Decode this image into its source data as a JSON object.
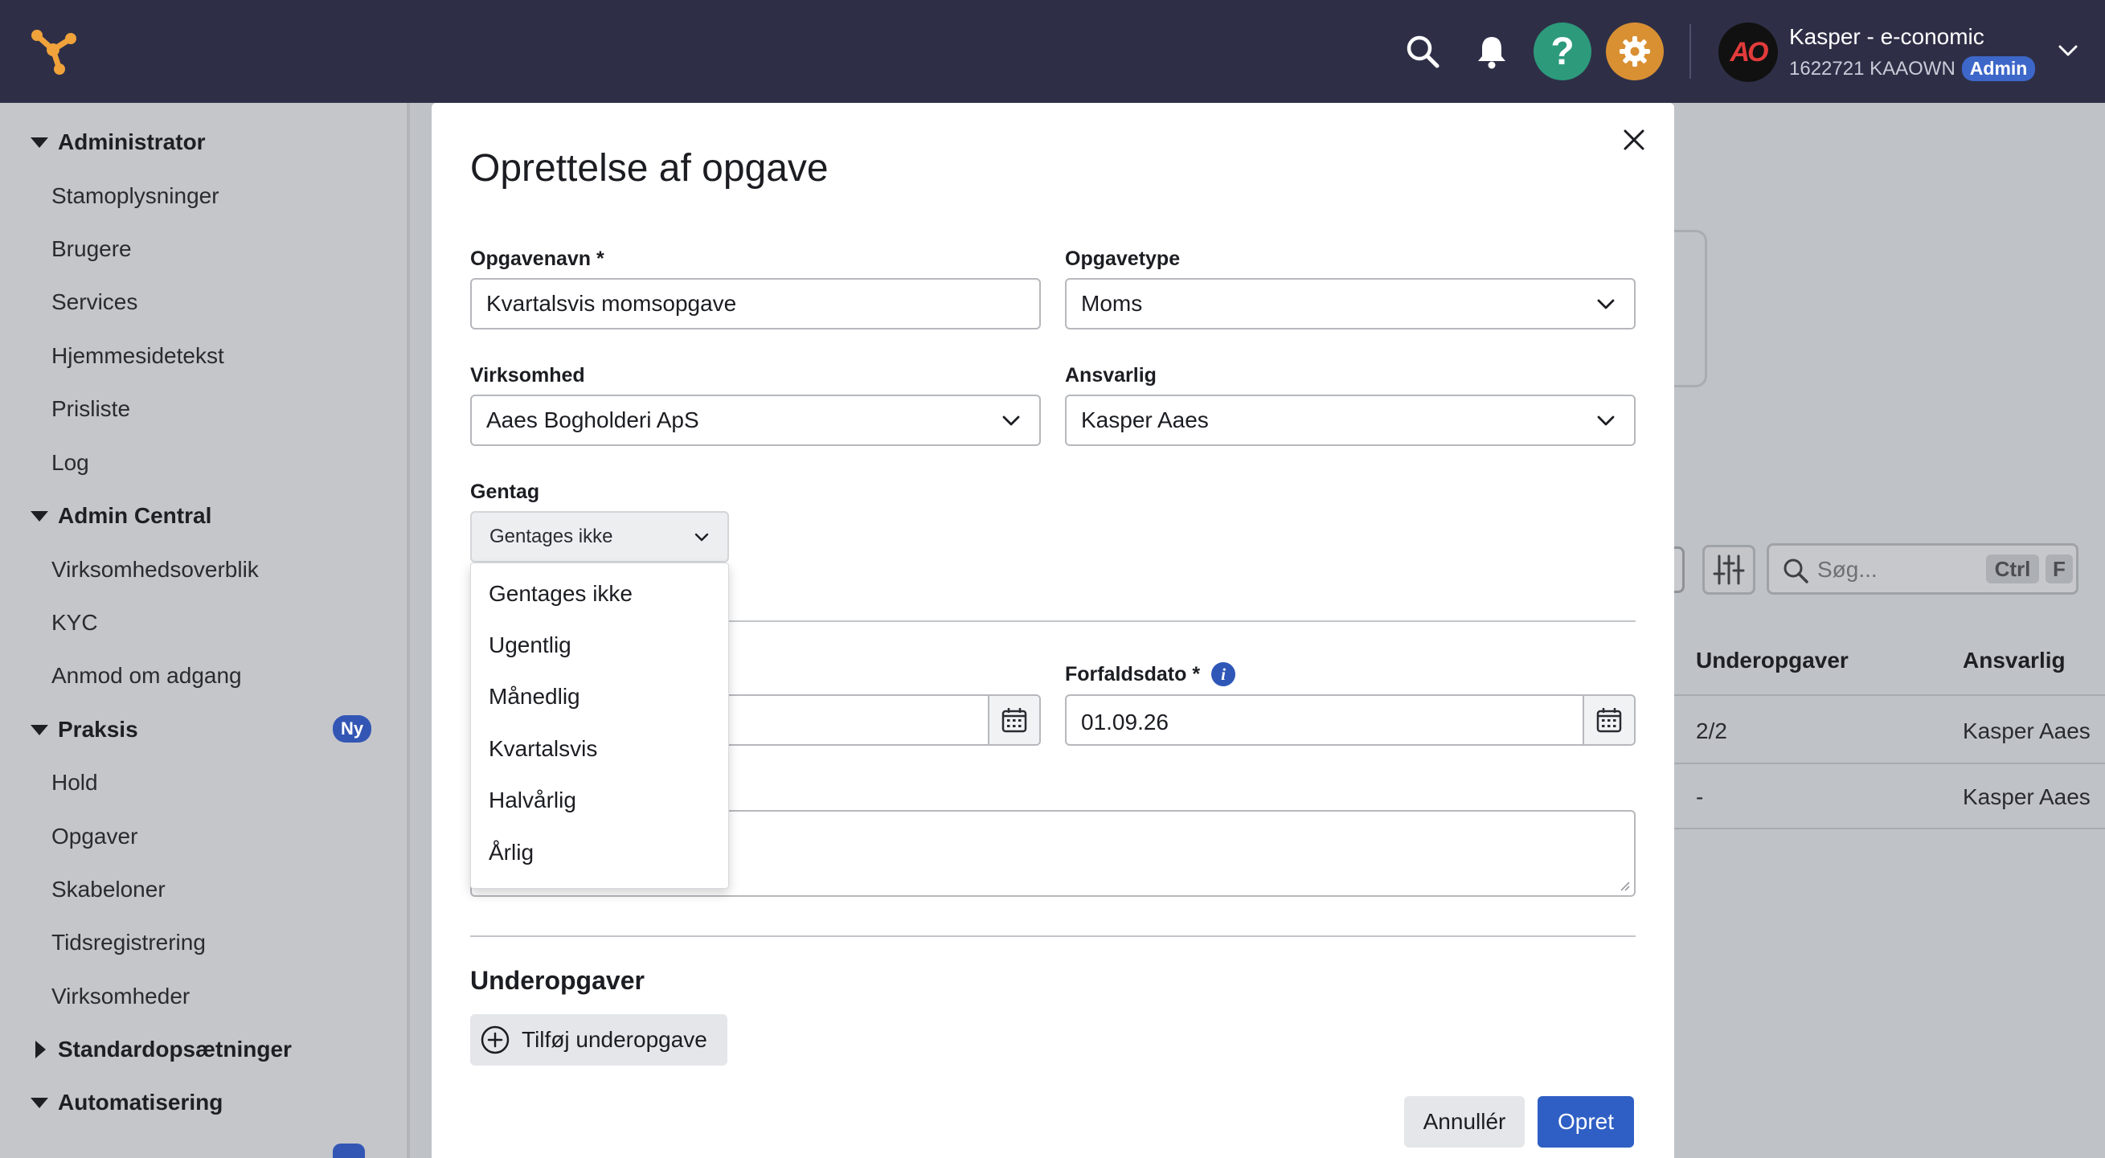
{
  "header": {
    "user_name": "Kasper - e-conomic",
    "user_sub": "1622721 KAAOWN",
    "role_badge": "Admin",
    "avatar_initials": "AO",
    "help_glyph": "?",
    "colors": {
      "bar": "#2e2f47",
      "help": "#2d9a7c",
      "settings": "#d99033",
      "accent": "#2f5fc4"
    },
    "icons": [
      "logo-icon",
      "search-icon",
      "bell-icon",
      "help-icon",
      "gear-icon",
      "chevron-down-icon"
    ]
  },
  "sidebar": {
    "sections": [
      {
        "label": "Administrator",
        "expanded": true,
        "items": [
          "Stamoplysninger",
          "Brugere",
          "Services",
          "Hjemmesidetekst",
          "Prisliste",
          "Log"
        ]
      },
      {
        "label": "Admin Central",
        "expanded": true,
        "items": [
          "Virksomhedsoverblik",
          "KYC",
          "Anmod om adgang"
        ]
      },
      {
        "label": "Praksis",
        "expanded": true,
        "badge": "Ny",
        "items": [
          "Hold",
          "Opgaver",
          "Skabeloner",
          "Tidsregistrering",
          "Virksomheder"
        ]
      },
      {
        "label": "Standardopsætninger",
        "expanded": false,
        "items": []
      },
      {
        "label": "Automatisering",
        "expanded": true,
        "items": []
      }
    ]
  },
  "background": {
    "search_placeholder": "Søg...",
    "kbd_ctrl": "Ctrl",
    "kbd_f": "F",
    "columns": [
      "Underopgaver",
      "Ansvarlig"
    ],
    "rows": [
      [
        "2/2",
        "Kasper Aaes"
      ],
      [
        "-",
        "Kasper Aaes"
      ]
    ]
  },
  "modal": {
    "title": "Oprettelse af opgave",
    "task_name_label": "Opgavenavn *",
    "task_name_value": "Kvartalsvis momsopgave",
    "task_type_label": "Opgavetype",
    "task_type_value": "Moms",
    "company_label": "Virksomhed",
    "company_value": "Aaes Bogholderi ApS",
    "responsible_label": "Ansvarlig",
    "responsible_value": "Kasper Aaes",
    "repeat_label": "Gentag",
    "repeat_value": "Gentages ikke",
    "repeat_options": [
      "Gentages ikke",
      "Ugentlig",
      "Månedlig",
      "Kvartalsvis",
      "Halvårlig",
      "Årlig"
    ],
    "due_label": "Forfaldsdato *",
    "due_value": "01.09.26",
    "info_glyph": "i",
    "subtasks_title": "Underopgaver",
    "add_subtask_label": "Tilføj underopgave",
    "cancel_label": "Annullér",
    "create_label": "Opret"
  }
}
